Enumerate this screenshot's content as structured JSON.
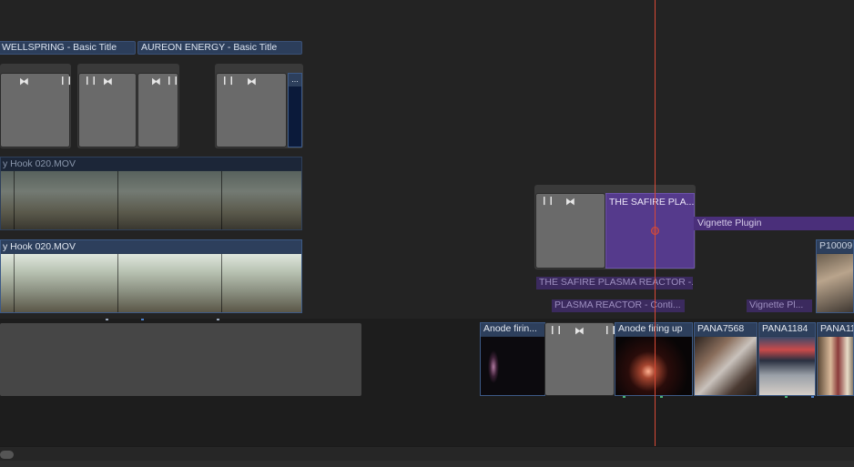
{
  "titles": {
    "wellspring": "WELLSPRING - Basic Title",
    "aureon": "AUREON ENERGY - Basic Title"
  },
  "connected_clips": {
    "row1_label": "y Hook 020.MOV",
    "row2_label": "y Hook 020.MOV",
    "safire_clip": "THE SAFIRE PLA...",
    "vignette_bar": "Vignette Plugin",
    "p1000_label": "P10009",
    "safire_sub": "THE SAFIRE PLASMA REACTOR -...",
    "plasma_sub": "PLASMA REACTOR - Conti...",
    "vignette_sub": "Vignette Pl..."
  },
  "primary_clips": [
    {
      "label": "Anode firin..."
    },
    {
      "label": "Anode firing up"
    },
    {
      "label": "PANA7568"
    },
    {
      "label": "PANA1184"
    },
    {
      "label": "PANA11"
    }
  ],
  "glyphs": {
    "pause": "❙❙",
    "bowtie": "⧓",
    "ellipsis": "..."
  },
  "colors": {
    "title_clip": "#2c3e5b",
    "purple_effect": "#553a8c",
    "playhead": "#d84a36",
    "primary_clip": "#2a3b55"
  }
}
